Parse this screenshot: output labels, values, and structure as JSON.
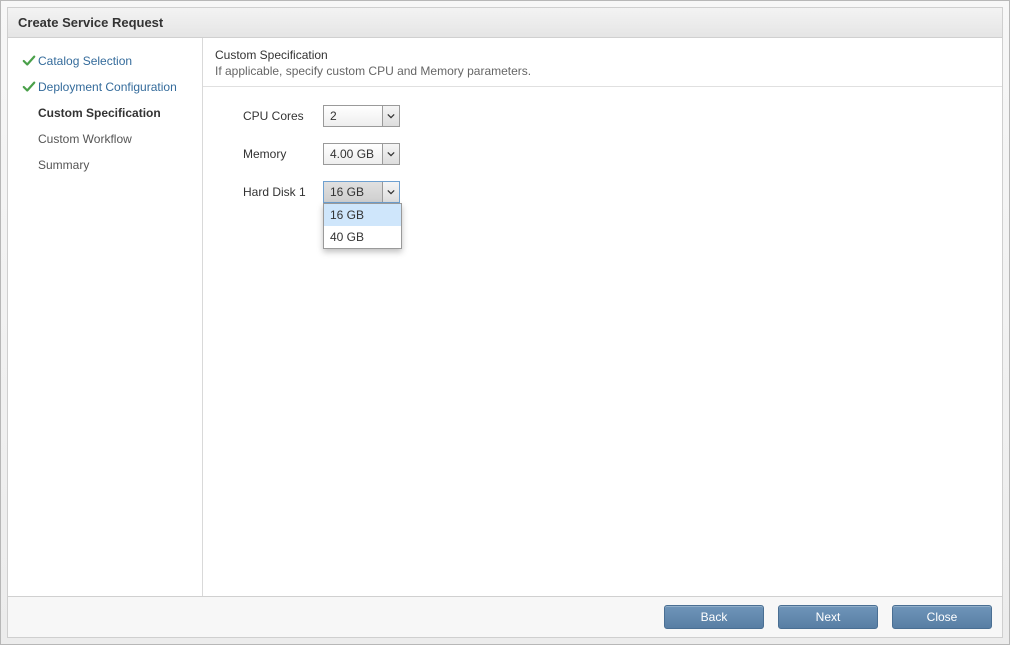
{
  "title": "Create Service Request",
  "sidebar": {
    "steps": [
      {
        "label": "Catalog Selection",
        "state": "completed"
      },
      {
        "label": "Deployment Configuration",
        "state": "completed"
      },
      {
        "label": "Custom Specification",
        "state": "current"
      },
      {
        "label": "Custom Workflow",
        "state": "pending"
      },
      {
        "label": "Summary",
        "state": "pending"
      }
    ]
  },
  "main": {
    "heading": "Custom Specification",
    "subheading": "If applicable, specify custom CPU and Memory parameters.",
    "fields": {
      "cpu": {
        "label": "CPU Cores",
        "value": "2"
      },
      "memory": {
        "label": "Memory",
        "value": "4.00 GB"
      },
      "harddisk": {
        "label": "Hard Disk 1",
        "value": "16 GB",
        "options": [
          "16 GB",
          "40 GB"
        ],
        "open": true,
        "selected_index": 0
      }
    }
  },
  "footer": {
    "back": "Back",
    "next": "Next",
    "close": "Close"
  }
}
